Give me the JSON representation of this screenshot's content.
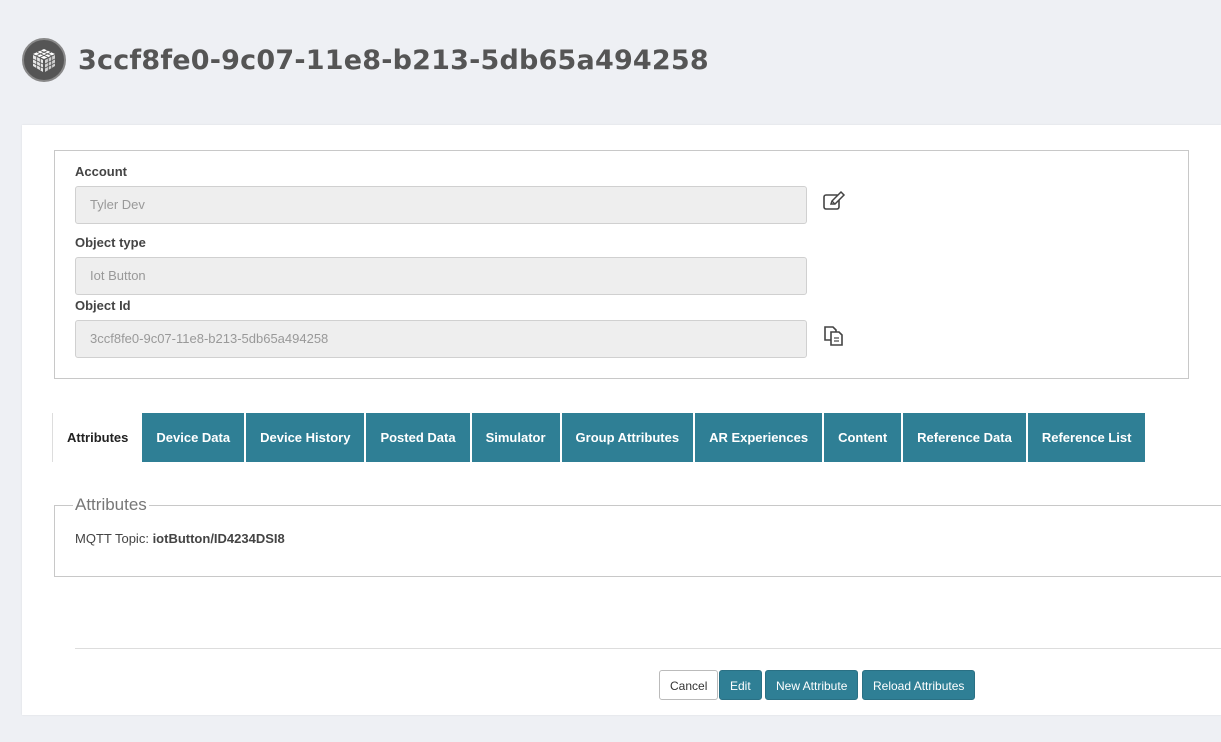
{
  "header": {
    "title": "3ccf8fe0-9c07-11e8-b213-5db65a494258",
    "logo_icon": "cube-icon"
  },
  "fields": {
    "account": {
      "label": "Account",
      "value": "Tyler Dev"
    },
    "object_type": {
      "label": "Object type",
      "value": "Iot Button"
    },
    "object_id": {
      "label": "Object Id",
      "value": "3ccf8fe0-9c07-11e8-b213-5db65a494258"
    }
  },
  "tabs": [
    "Attributes",
    "Device Data",
    "Device History",
    "Posted Data",
    "Simulator",
    "Group Attributes",
    "AR Experiences",
    "Content",
    "Reference Data",
    "Reference List"
  ],
  "attributes": {
    "legend": "Attributes",
    "mqtt_label": "MQTT Topic:",
    "mqtt_value": "iotButton/ID4234DSI8"
  },
  "buttons": {
    "cancel": "Cancel",
    "edit": "Edit",
    "new_attribute": "New Attribute",
    "reload_attributes": "Reload Attributes"
  },
  "colors": {
    "accent": "#2f7f95",
    "background": "#eef0f4"
  }
}
